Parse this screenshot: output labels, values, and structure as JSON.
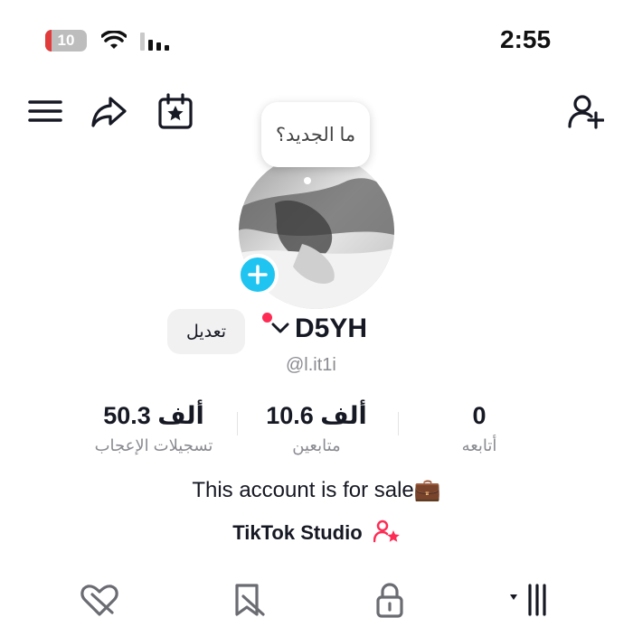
{
  "status_bar": {
    "battery": "10",
    "time": "2:55"
  },
  "profile": {
    "whats_new": "ما الجديد؟",
    "edit_label": "تعديل",
    "username": "D5YH",
    "handle": "@l.it1i",
    "bio": "This account is for sale💼",
    "studio_label": "TikTok Studio"
  },
  "stats": [
    {
      "value": "50.3 ألف",
      "label": "تسجيلات الإعجاب"
    },
    {
      "value": "10.6 ألف",
      "label": "متابعين"
    },
    {
      "value": "0",
      "label": "أتابعه"
    }
  ],
  "icons": {
    "menu": "menu-icon",
    "share": "share-icon",
    "calendar": "calendar-star-icon",
    "add_user": "add-user-icon",
    "liked": "heart-slash-icon",
    "saved": "bookmark-slash-icon",
    "private": "lock-icon",
    "videos": "grid-icon"
  },
  "colors": {
    "accent_blue": "#20c4f0",
    "accent_red": "#fe2c55",
    "text": "#161823",
    "muted": "#8a8b91"
  }
}
